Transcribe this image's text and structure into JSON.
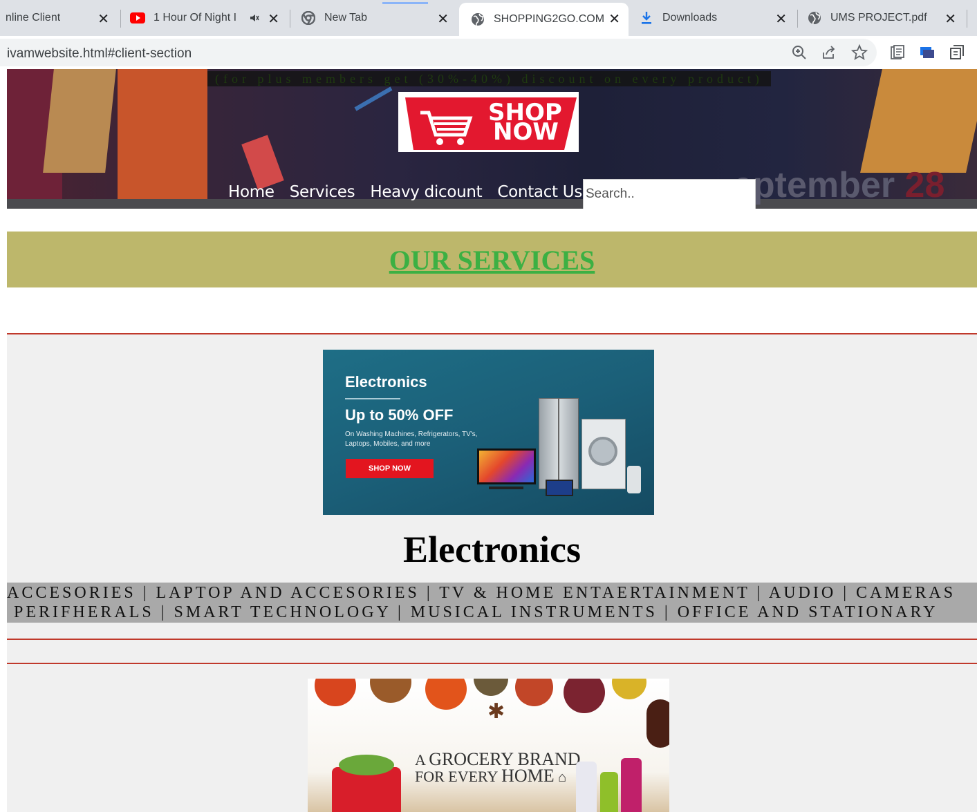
{
  "browser": {
    "tabs": [
      {
        "title": "nline Client",
        "icon": "globe-icon",
        "active": false
      },
      {
        "title": "1 Hour Of Night I",
        "icon": "youtube-icon",
        "active": false,
        "muted_icon": "speaker-icon"
      },
      {
        "title": "New Tab",
        "icon": "chrome-icon",
        "active": false
      },
      {
        "title": "SHOPPING2GO.COM",
        "icon": "globe-icon",
        "active": true
      },
      {
        "title": "Downloads",
        "icon": "download-icon",
        "active": false
      },
      {
        "title": "UMS PROJECT.pdf",
        "icon": "globe-icon",
        "active": false
      }
    ],
    "close_glyph": "✕",
    "url": "ivamwebsite.html#client-section"
  },
  "header": {
    "promo": "(for plus members get (30%-40%) discount on every product)",
    "logo": {
      "line1": "SHOP",
      "line2": "NOW",
      "brand_color": "#e3182f"
    },
    "nav": [
      "Home",
      "Services",
      "Heavy dicount",
      "Contact Us"
    ],
    "search_placeholder": "Search..",
    "date_word": "eptember",
    "date_num": "28"
  },
  "services": {
    "title": "OUR SERVICES",
    "band_color": "#bdb76b",
    "title_color": "#3cb043"
  },
  "electronics": {
    "banner": {
      "heading": "Electronics",
      "offer": "Up to 50% OFF",
      "details": "On Washing Machines, Refrigerators, TV's, Laptops, Mobiles, and more",
      "button": "SHOP NOW"
    },
    "title": "Electronics",
    "categories_line1": "ACCESORIES | LAPTOP AND ACCESORIES | TV & HOME ENTAERTAINMENT | AUDIO | CAMERAS",
    "categories_line2": "PERIFHERALS | SMART TECHNOLOGY | MUSICAL INSTRUMENTS | OFFICE AND STATIONARY"
  },
  "grocery": {
    "line1_a": "A",
    "line1_b": "GROCERY BRAND",
    "line2_a": "FOR EVERY",
    "line2_b": "HOME"
  }
}
